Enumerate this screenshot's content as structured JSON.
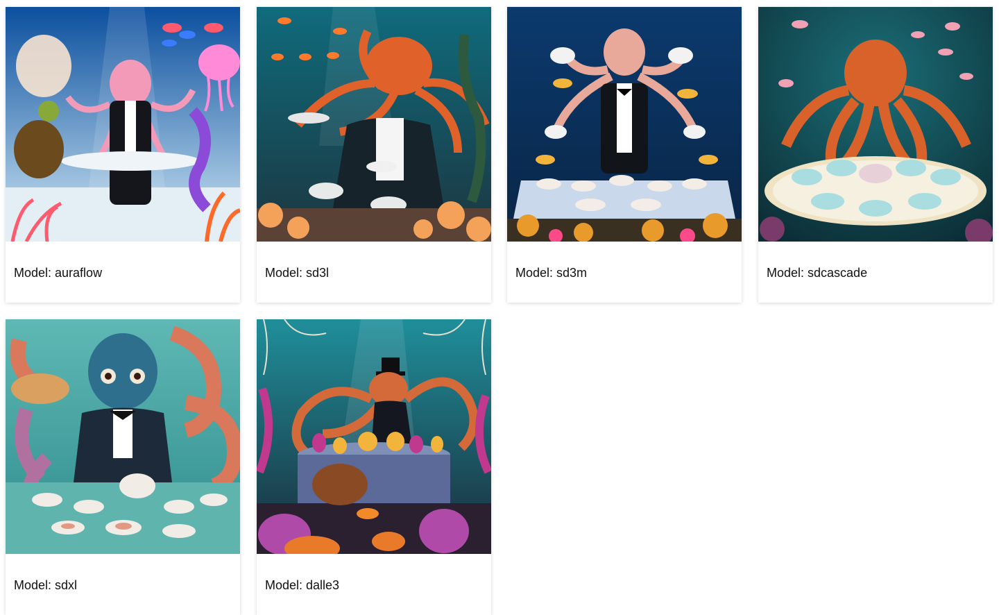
{
  "cards": [
    {
      "caption": "Model: auraflow",
      "image_alt": "octopus tea party illustration with turtle, jellyfish and seahorse",
      "palette": {
        "top": "#0b4f9e",
        "bottom": "#cfe8f5",
        "octopus": "#f29ab8",
        "accent": "#ff5a6e"
      }
    },
    {
      "caption": "Model: sd3l",
      "image_alt": "orange octopus in tuxedo pouring tea on a coral reef",
      "palette": {
        "top": "#0f6b7c",
        "bottom": "#1c3640",
        "octopus": "#e0622a",
        "accent": "#f4a25a"
      }
    },
    {
      "caption": "Model: sd3m",
      "image_alt": "pale octopus butler holding teapots over a table of teacups",
      "palette": {
        "top": "#0b3a6e",
        "bottom": "#0a2545",
        "octopus": "#e8a99b",
        "accent": "#f2b43a"
      }
    },
    {
      "caption": "Model: sdcascade",
      "image_alt": "orange octopus spread over a round tea tray with blue cups",
      "palette": {
        "top": "#1b6f78",
        "bottom": "#0c2d35",
        "octopus": "#d9622b",
        "accent": "#a9dde0"
      }
    },
    {
      "caption": "Model: sdxl",
      "image_alt": "blue octopus in tuxedo at a tea table with teapots",
      "palette": {
        "top": "#5fb8b4",
        "bottom": "#2f8d8d",
        "octopus": "#2f6f8e",
        "accent": "#d9785a"
      }
    },
    {
      "caption": "Model: dalle3",
      "image_alt": "octopus in top hat at a colorful underwater tea party",
      "palette": {
        "top": "#1f8f9a",
        "bottom": "#1a2b3a",
        "octopus": "#d46a3a",
        "accent": "#c0398e"
      }
    }
  ]
}
